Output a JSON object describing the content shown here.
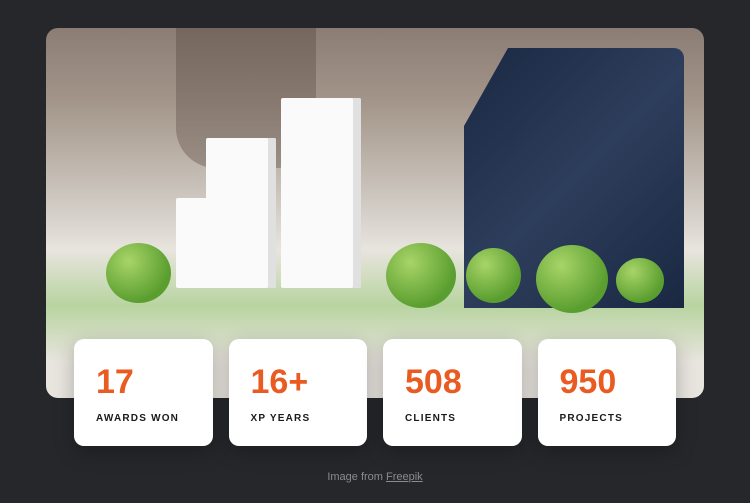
{
  "stats": [
    {
      "value": "17",
      "label": "AWARDS WON"
    },
    {
      "value": "16+",
      "label": "XP YEARS"
    },
    {
      "value": "508",
      "label": "CLIENTS"
    },
    {
      "value": "950",
      "label": "PROJECTS"
    }
  ],
  "attribution": {
    "prefix": "Image from ",
    "source": "Freepik"
  }
}
